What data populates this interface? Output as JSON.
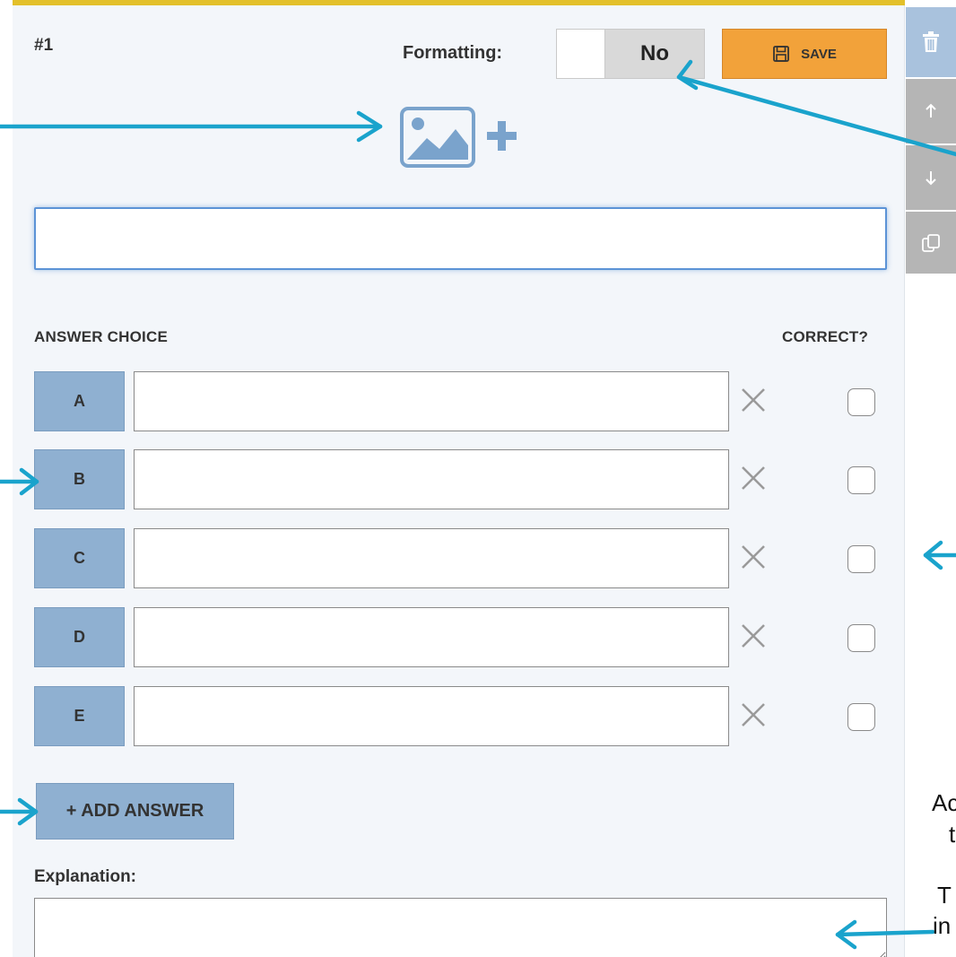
{
  "question": {
    "number": "#1",
    "formatting_label": "Formatting:",
    "formatting_value": "No",
    "save_label": "SAVE",
    "question_text": ""
  },
  "side_toolbar": {
    "icons": [
      "trash-icon",
      "arrow-up-icon",
      "arrow-down-icon",
      "copy-icon"
    ]
  },
  "answers": {
    "header_choice": "ANSWER CHOICE",
    "header_correct": "CORRECT?",
    "choices": [
      {
        "letter": "A",
        "text": "",
        "correct": false
      },
      {
        "letter": "B",
        "text": "",
        "correct": false
      },
      {
        "letter": "C",
        "text": "",
        "correct": false
      },
      {
        "letter": "D",
        "text": "",
        "correct": false
      },
      {
        "letter": "E",
        "text": "",
        "correct": false
      }
    ],
    "add_label": "+ ADD ANSWER"
  },
  "explanation": {
    "label": "Explanation:",
    "text": ""
  },
  "annotation_fragments": {
    "line1": "Ac",
    "line2": "t",
    "line3": "T",
    "line4": "in"
  },
  "colors": {
    "accent_bar": "#e3c02a",
    "save": "#f2a23a",
    "letter_button": "#8fb0d1",
    "focus": "#5c93d6",
    "annotation_arrow": "#1aa3cc"
  }
}
